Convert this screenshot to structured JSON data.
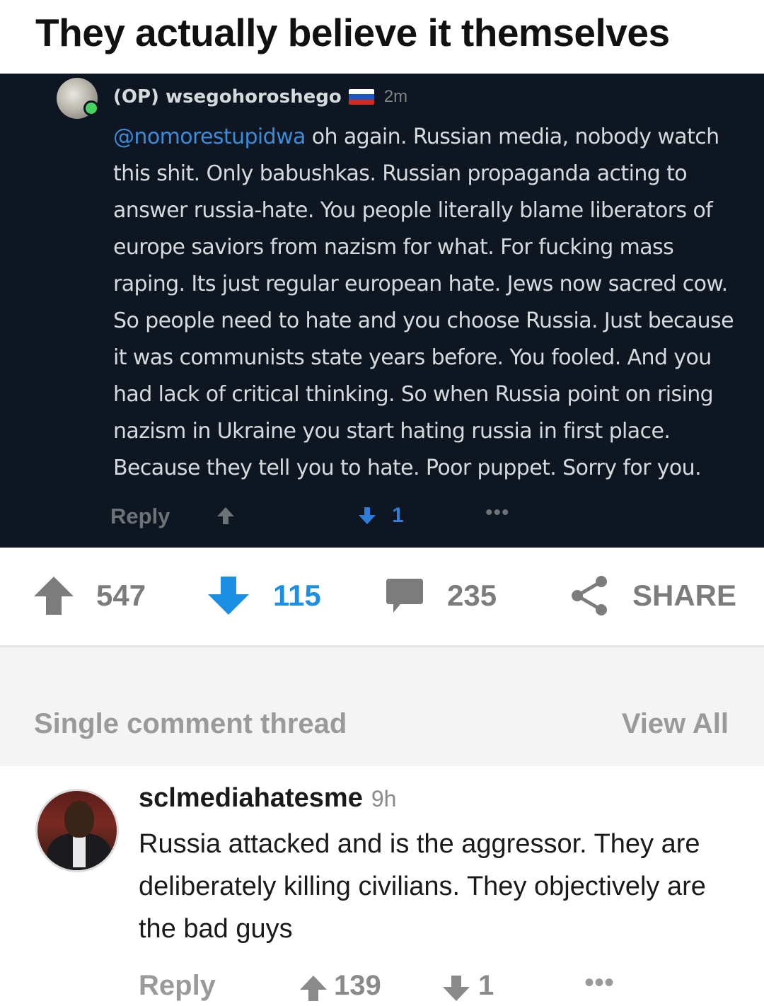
{
  "post": {
    "title": "They actually believe it themselves"
  },
  "embedded_comment": {
    "op_tag": "(OP) wsegohoroshego",
    "flag": "russia-flag-icon",
    "flag_colors": [
      "#ffffff",
      "#1c57c4",
      "#d52b1e"
    ],
    "time": "2m",
    "mention": "@nomorestupidwa",
    "text": " oh again. Russian media, nobody watch this shit. Only babushkas. Russian propaganda acting to answer russia-hate. You people literally blame liberators of europe saviors from nazism for what. For fucking mass raping. Its just regular european hate. Jews now sacred cow. So people need to hate and you choose Russia. Just because it was communists state years before. You fooled. And you had lack of critical thinking. So when Russia point on rising nazism in Ukraine you start hating russia in first place. Because they tell you to hate. Poor puppet. Sorry for you.",
    "reply_label": "Reply",
    "downvote_count": "1",
    "more": "•••",
    "accent_blue": "#2e7ddb"
  },
  "actions": {
    "upvotes": "547",
    "downvotes": "115",
    "comments": "235",
    "share": "SHARE",
    "downvote_color": "#1a8fe3"
  },
  "thread": {
    "label": "Single comment thread",
    "view_all": "View All"
  },
  "comment": {
    "username": "sclmediahatesme",
    "time": "9h",
    "text": "Russia attacked and is the aggressor. They are deliberately killing civilians. They objectively are the bad guys",
    "reply_label": "Reply",
    "upvotes": "139",
    "downvotes": "1",
    "more": "•••"
  }
}
